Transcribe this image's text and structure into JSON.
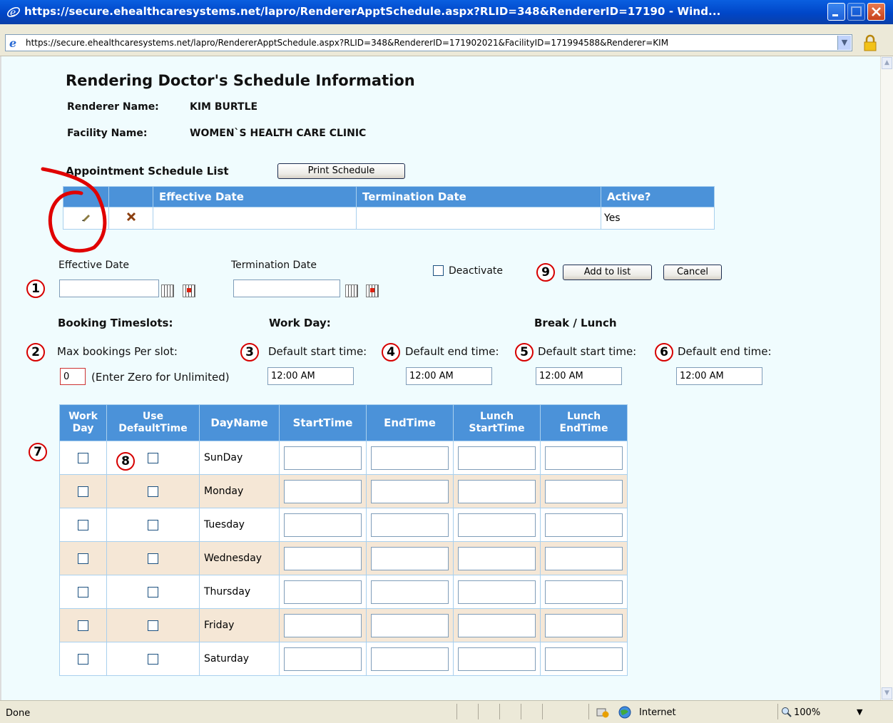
{
  "window": {
    "title": "https://secure.ehealthcaresystems.net/lapro/RendererApptSchedule.aspx?RLID=348&RendererID=17190 - Wind...",
    "address": "https://secure.ehealthcaresystems.net/lapro/RendererApptSchedule.aspx?RLID=348&RendererID=171902021&FacilityID=171994588&Renderer=KIM"
  },
  "page": {
    "title": "Rendering Doctor's Schedule Information",
    "renderer_label": "Renderer Name:",
    "renderer_value": "KIM BURTLE",
    "facility_label": "Facility Name:",
    "facility_value": "WOMEN`S HEALTH CARE CLINIC"
  },
  "list": {
    "heading": "Appointment Schedule List",
    "print_label": "Print Schedule",
    "columns": [
      "",
      "",
      "Effective Date",
      "Termination Date",
      "Active?"
    ],
    "rows": [
      {
        "effective": "",
        "termination": "",
        "active": "Yes"
      }
    ]
  },
  "form": {
    "effective_label": "Effective Date",
    "termination_label": "Termination Date",
    "deactivate_label": "Deactivate",
    "add_label": "Add to list",
    "cancel_label": "Cancel",
    "booking_heading": "Booking Timeslots:",
    "workday_heading": "Work Day:",
    "break_heading": "Break / Lunch",
    "max_label": "Max bookings Per slot:",
    "max_value": "0",
    "max_hint": "(Enter Zero for Unlimited)",
    "work_start_label": "Default start time:",
    "work_end_label": "Default end time:",
    "break_start_label": "Default start time:",
    "break_end_label": "Default end time:",
    "work_start_value": "12:00 AM",
    "work_end_value": "12:00 AM",
    "break_start_value": "12:00 AM",
    "break_end_value": "12:00 AM"
  },
  "markers": [
    "1",
    "2",
    "3",
    "4",
    "5",
    "6",
    "7",
    "8",
    "9"
  ],
  "schedule": {
    "headers": {
      "work_day": [
        "Work",
        "Day"
      ],
      "use_default": [
        "Use",
        "DefaultTime"
      ],
      "day_name": "DayName",
      "start": "StartTime",
      "end": "EndTime",
      "lunch_start": [
        "Lunch",
        "StartTime"
      ],
      "lunch_end": [
        "Lunch",
        "EndTime"
      ]
    },
    "days": [
      "SunDay",
      "Monday",
      "Tuesday",
      "Wednesday",
      "Thursday",
      "Friday",
      "Saturday"
    ]
  },
  "status": {
    "text": "Done",
    "zone": "Internet",
    "zoom": "100%"
  },
  "colors": {
    "header_blue": "#4b92d9",
    "alt_row": "#f5e7d6",
    "page_bg": "#f0fcfe",
    "annotation_red": "#d60000"
  }
}
